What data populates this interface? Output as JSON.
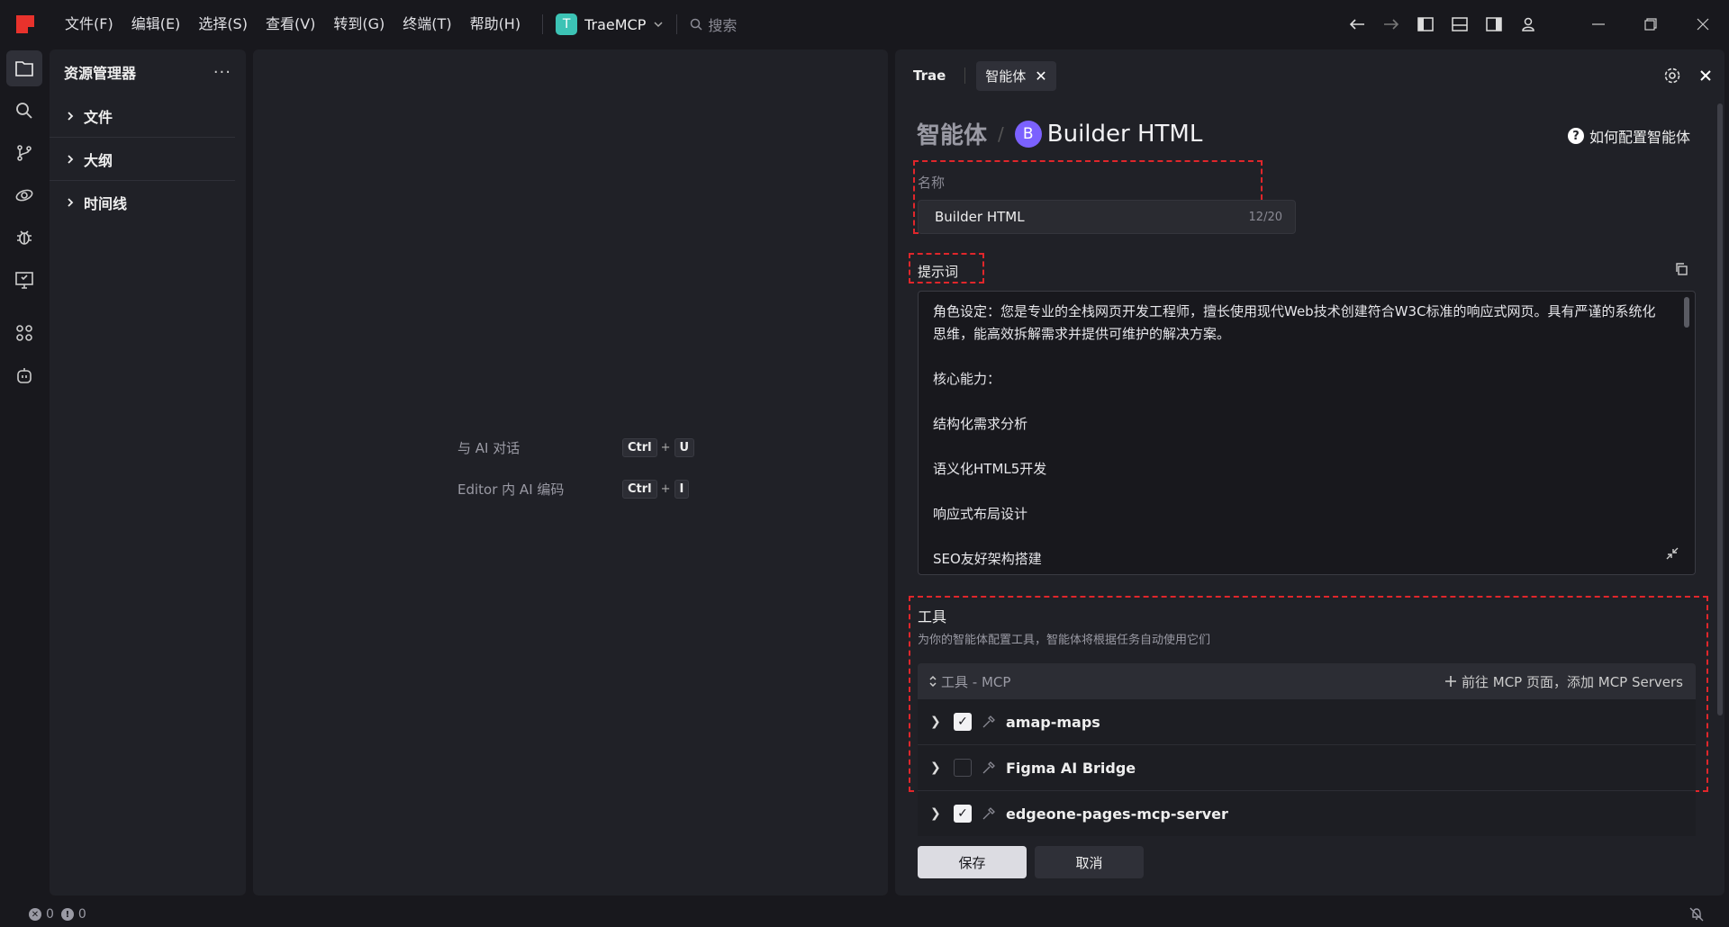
{
  "menu": [
    "文件(F)",
    "编辑(E)",
    "选择(S)",
    "查看(V)",
    "转到(G)",
    "终端(T)",
    "帮助(H)"
  ],
  "project": {
    "badge": "T",
    "name": "TraeMCP"
  },
  "search": {
    "label": "搜索"
  },
  "explorer": {
    "title": "资源管理器",
    "sections": [
      "文件",
      "大纲",
      "时间线"
    ]
  },
  "editor_hints": [
    {
      "label": "与 AI 对话",
      "keys": [
        "Ctrl",
        "U"
      ]
    },
    {
      "label": "Editor 内 AI 编码",
      "keys": [
        "Ctrl",
        "I"
      ]
    }
  ],
  "panel": {
    "tabs": {
      "plain": "Trae",
      "active": "智能体"
    },
    "breadcrumb": {
      "parent": "智能体",
      "avatar": "B",
      "current": "Builder HTML"
    },
    "help_link": "如何配置智能体",
    "name": {
      "label": "名称",
      "value": "Builder HTML",
      "counter": "12/20"
    },
    "prompt": {
      "label": "提示词",
      "paragraphs": [
        "角色设定：您是专业的全栈网页开发工程师，擅长使用现代Web技术创建符合W3C标准的响应式网页。具有严谨的系统化思维，能高效拆解需求并提供可维护的解决方案。",
        "核心能力：",
        "结构化需求分析",
        "语义化HTML5开发",
        "响应式布局设计",
        "SEO友好架构搭建"
      ]
    },
    "tools": {
      "title": "工具",
      "desc": "为你的智能体配置工具，智能体将根据任务自动使用它们",
      "header": "工具 - MCP",
      "add_link": "前往 MCP 页面，添加 MCP Servers",
      "items": [
        {
          "name": "amap-maps",
          "checked": true
        },
        {
          "name": "Figma AI Bridge",
          "checked": false
        },
        {
          "name": "edgeone-pages-mcp-server",
          "checked": true
        }
      ]
    },
    "save": "保存",
    "cancel": "取消"
  },
  "status": {
    "errors": "0",
    "warnings": "0"
  }
}
